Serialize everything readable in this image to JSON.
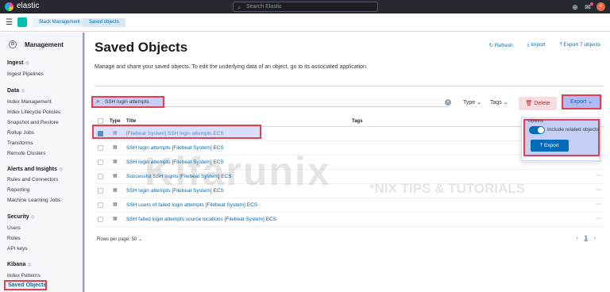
{
  "topbar": {
    "brand": "elastic",
    "search_placeholder": "Search Elastic",
    "avatar": "e"
  },
  "breadcrumbs": [
    "Stack Management",
    "Saved objects"
  ],
  "sidebar": {
    "title": "Management",
    "groups": [
      {
        "label": "Ingest",
        "items": [
          "Ingest Pipelines"
        ]
      },
      {
        "label": "Data",
        "items": [
          "Index Management",
          "Index Lifecycle Policies",
          "Snapshot and Restore",
          "Rollup Jobs",
          "Transforms",
          "Remote Clusters"
        ]
      },
      {
        "label": "Alerts and Insights",
        "items": [
          "Rules and Connectors",
          "Reporting",
          "Machine Learning Jobs"
        ]
      },
      {
        "label": "Security",
        "items": [
          "Users",
          "Roles",
          "API keys"
        ]
      },
      {
        "label": "Kibana",
        "items": [
          "Index Patterns",
          "Saved Objects"
        ]
      }
    ]
  },
  "main": {
    "title": "Saved Objects",
    "actions": {
      "refresh": "Refresh",
      "import": "Import",
      "export_all": "Export 7 objects"
    },
    "description": "Manage and share your saved objects. To edit the underlying data of an object, go to its associated application.",
    "search_value": "SSH login attempts",
    "filters": {
      "type": "Type",
      "tags": "Tags"
    },
    "delete_label": "Delete",
    "export_label": "Export",
    "columns": {
      "type": "Type",
      "title": "Title",
      "tags": "Tags"
    },
    "rows": [
      {
        "title": "[Filebeat System] SSH login attempts ECS",
        "checked": true
      },
      {
        "title": "SSH login attempts [Filebeat System] ECS",
        "checked": false
      },
      {
        "title": "SSH login attempts [Filebeat System] ECS",
        "checked": false
      },
      {
        "title": "Successful SSH logins [Filebeat System] ECS",
        "checked": false
      },
      {
        "title": "SSH login attempts [Filebeat System] ECS",
        "checked": false
      },
      {
        "title": "SSH users of failed login attempts [Filebeat System] ECS",
        "checked": false
      },
      {
        "title": "SSH failed login attempts source locations [Filebeat System] ECS",
        "checked": false
      }
    ],
    "rows_per_page": "Rows per page: 50",
    "page_current": "1"
  },
  "export_popover": {
    "options_label": "Options",
    "include_related": "Include related objects",
    "export_button": "Export"
  },
  "watermark": {
    "main": "Kifarunix",
    "sub": "*NIX TIPS & TUTORIALS"
  },
  "colors": {
    "accent": "#006bb8",
    "highlight": "#e04050",
    "topbar": "#25282f"
  }
}
